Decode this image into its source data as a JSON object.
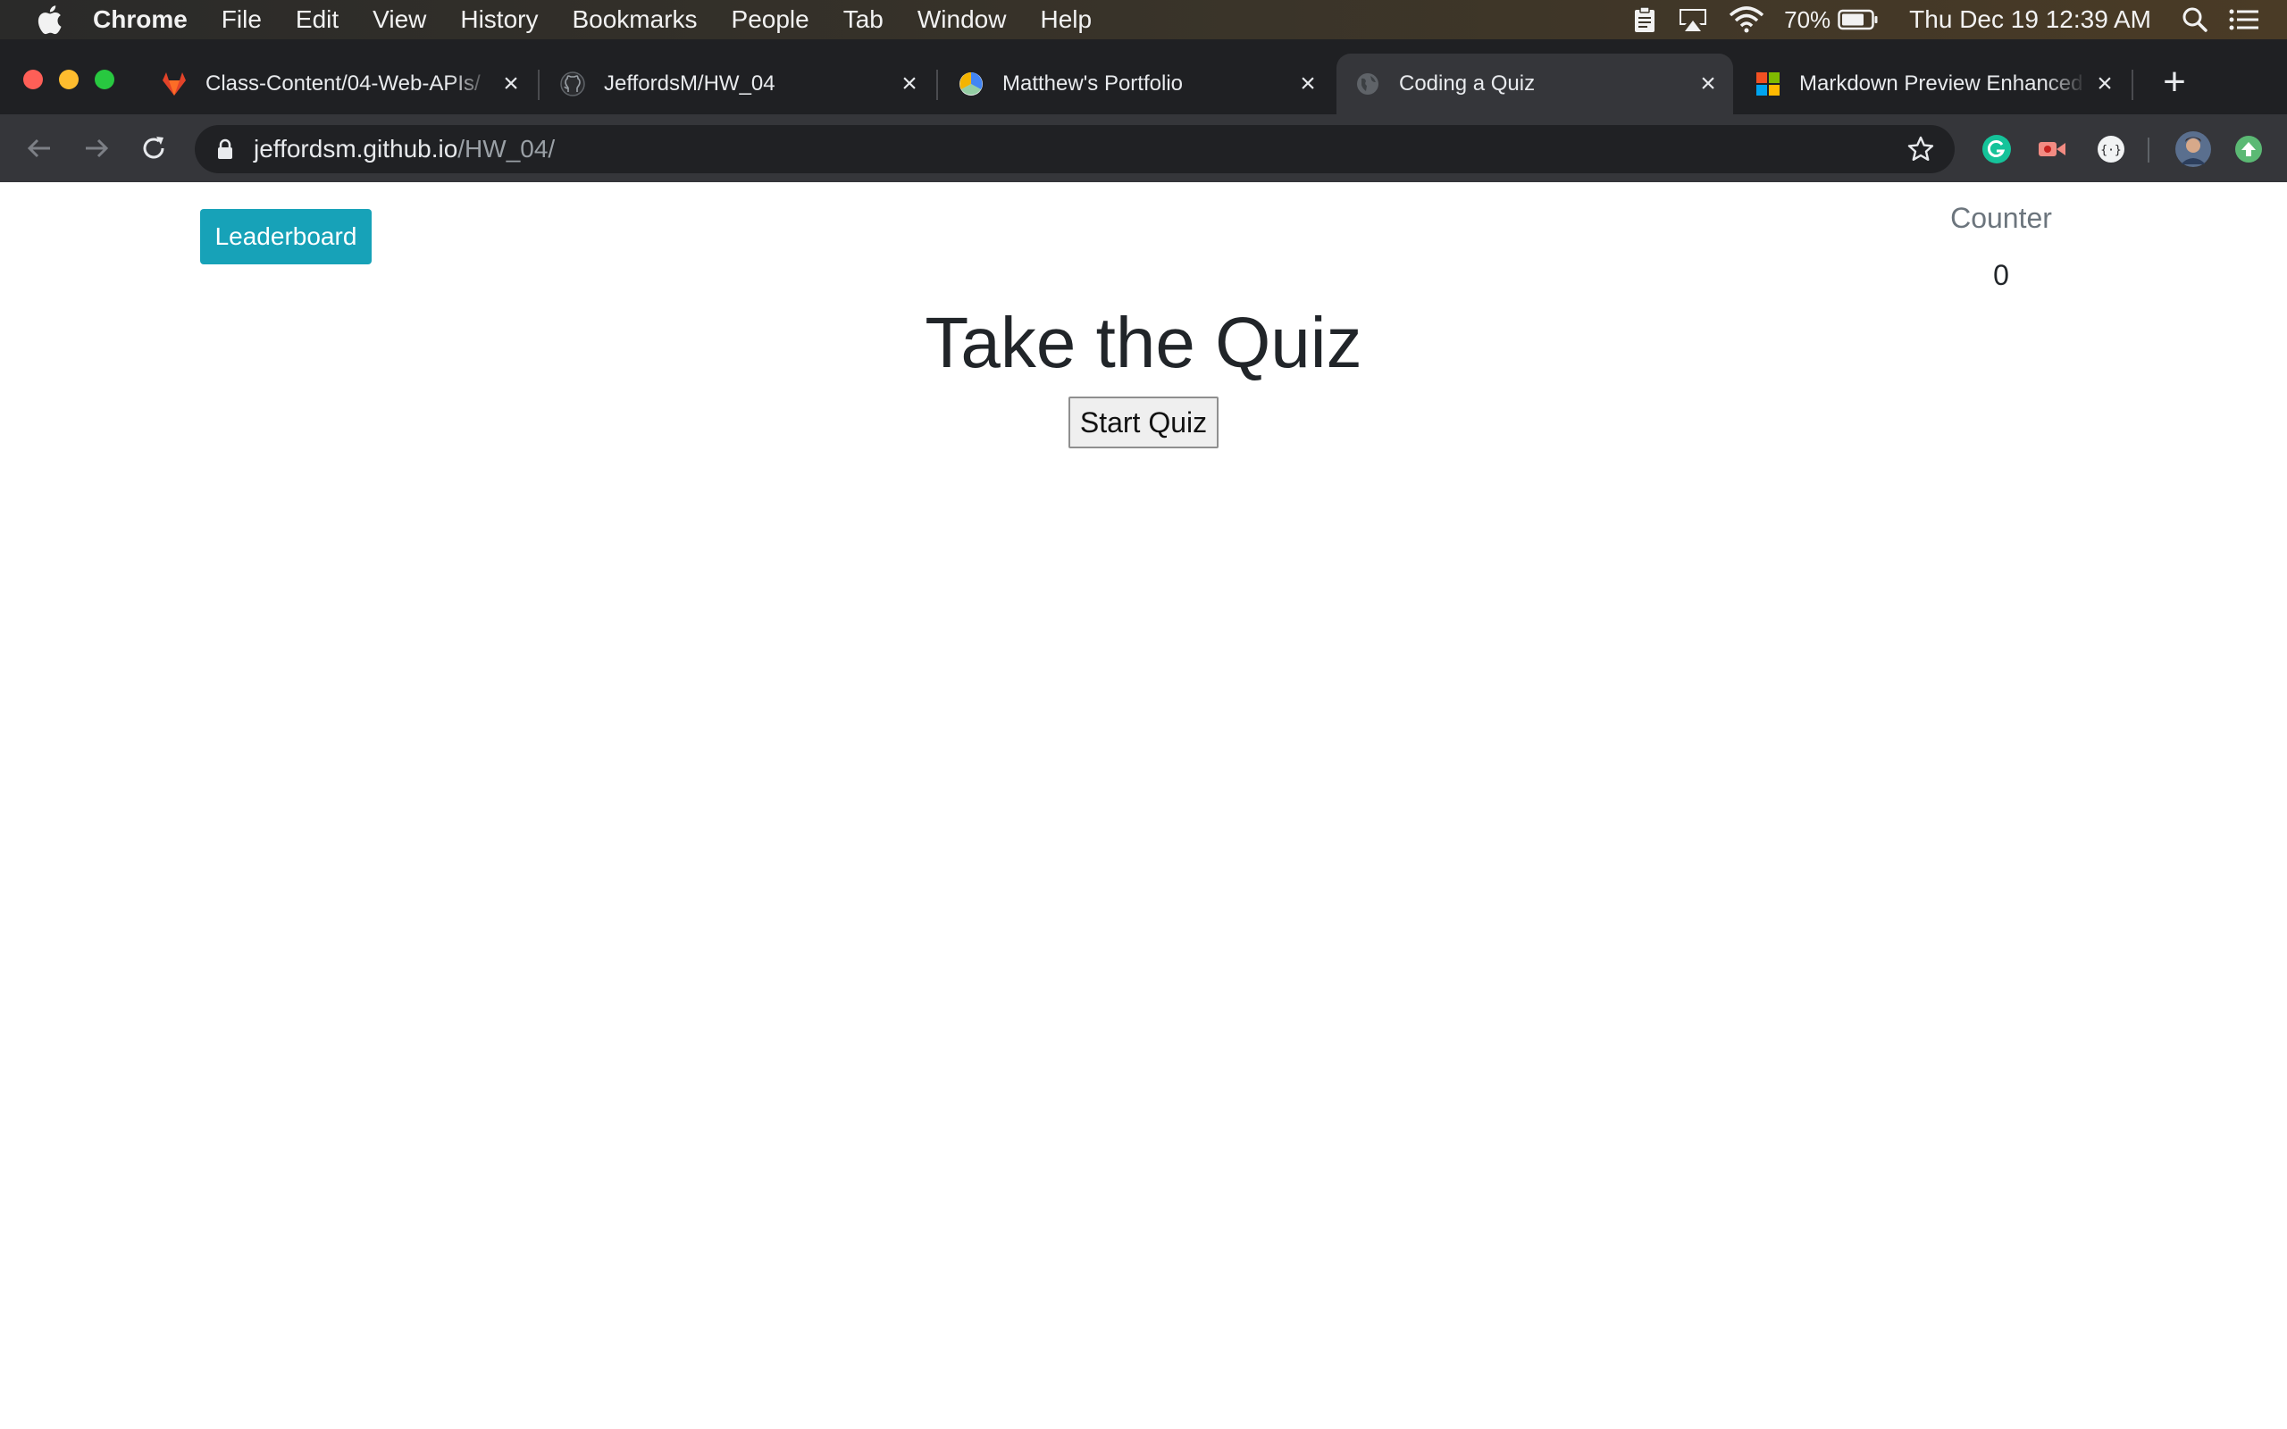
{
  "menubar": {
    "app_name": "Chrome",
    "items": [
      "File",
      "Edit",
      "View",
      "History",
      "Bookmarks",
      "People",
      "Tab",
      "Window",
      "Help"
    ],
    "battery_percent": "70%",
    "clock": "Thu Dec 19  12:39 AM"
  },
  "tabs": [
    {
      "title": "Class-Content/04-Web-APIs/",
      "favicon": "gitlab-icon",
      "active": false
    },
    {
      "title": "JeffordsM/HW_04",
      "favicon": "github-icon",
      "active": false
    },
    {
      "title": "Matthew's Portfolio",
      "favicon": "ball-icon",
      "active": false
    },
    {
      "title": "Coding a Quiz",
      "favicon": "globe-icon",
      "active": true
    },
    {
      "title": "Markdown Preview Enhanced",
      "favicon": "microsoft-icon",
      "active": false
    }
  ],
  "address_bar": {
    "host": "jeffordsm.github.io",
    "path": "/HW_04/"
  },
  "page": {
    "leaderboard_label": "Leaderboard",
    "counter_label": "Counter",
    "counter_value": "0",
    "title": "Take the Quiz",
    "start_label": "Start Quiz"
  },
  "colors": {
    "leaderboard_bg": "#17a2b8",
    "tab_strip_bg": "#1f2023",
    "toolbar_bg": "#35363a"
  }
}
